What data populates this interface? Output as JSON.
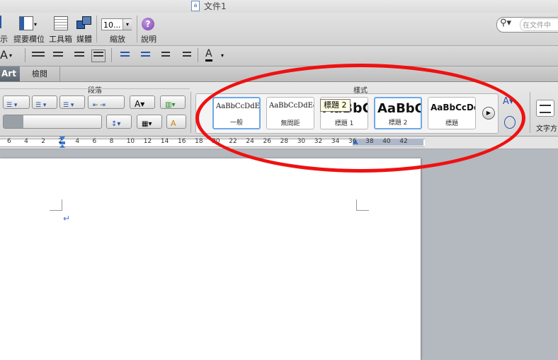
{
  "window": {
    "title": "文件1"
  },
  "toolbar": {
    "cut_label": "示",
    "sidebar_label": "提要欄位",
    "toolbox_label": "工具箱",
    "media_label": "媒體",
    "zoom_value": "10...",
    "zoom_label": "縮放",
    "help_label": "說明",
    "search_placeholder": "在文件中"
  },
  "tabs": [
    {
      "label": "Art"
    },
    {
      "label": "檢閱"
    }
  ],
  "ribbon": {
    "paragraph_group": "段落",
    "styles_group": "樣式",
    "tooltip": "標題 2",
    "text_box_label": "文字方",
    "styles": [
      {
        "sample": "AaBbCcDdEe",
        "name": "一般"
      },
      {
        "sample": "AaBbCcDdEe",
        "name": "無間距"
      },
      {
        "sample": "AaBbC",
        "name": "標題 1"
      },
      {
        "sample": "AaBbC",
        "name": "標題 2"
      },
      {
        "sample": "AaBbCcDc",
        "name": "標題"
      }
    ]
  },
  "ruler": {
    "ticks": [
      "6",
      "4",
      "2",
      "2",
      "4",
      "6",
      "8",
      "10",
      "12",
      "14",
      "16",
      "18",
      "20",
      "22",
      "24",
      "26",
      "28",
      "30",
      "32",
      "34",
      "36",
      "38",
      "40",
      "42"
    ]
  },
  "colors": {
    "highlight": "#ee1111",
    "selected_style": "#6ea9e6",
    "tab_active": "#5a636e"
  }
}
